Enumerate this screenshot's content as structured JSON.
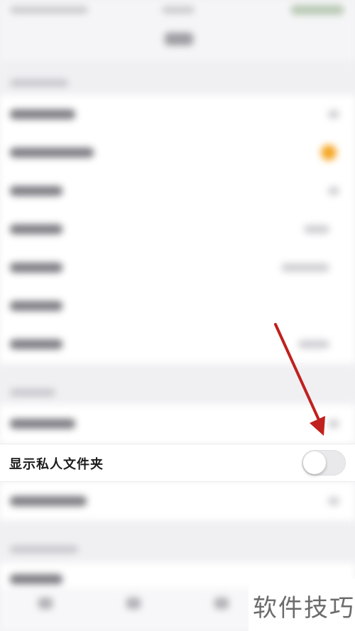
{
  "settings": {
    "private_folder_row": {
      "label": "显示私人文件夹",
      "toggle_on": false
    }
  },
  "watermark": {
    "text": "软件技巧"
  },
  "annotation": {
    "arrow_color": "#c0211e"
  }
}
